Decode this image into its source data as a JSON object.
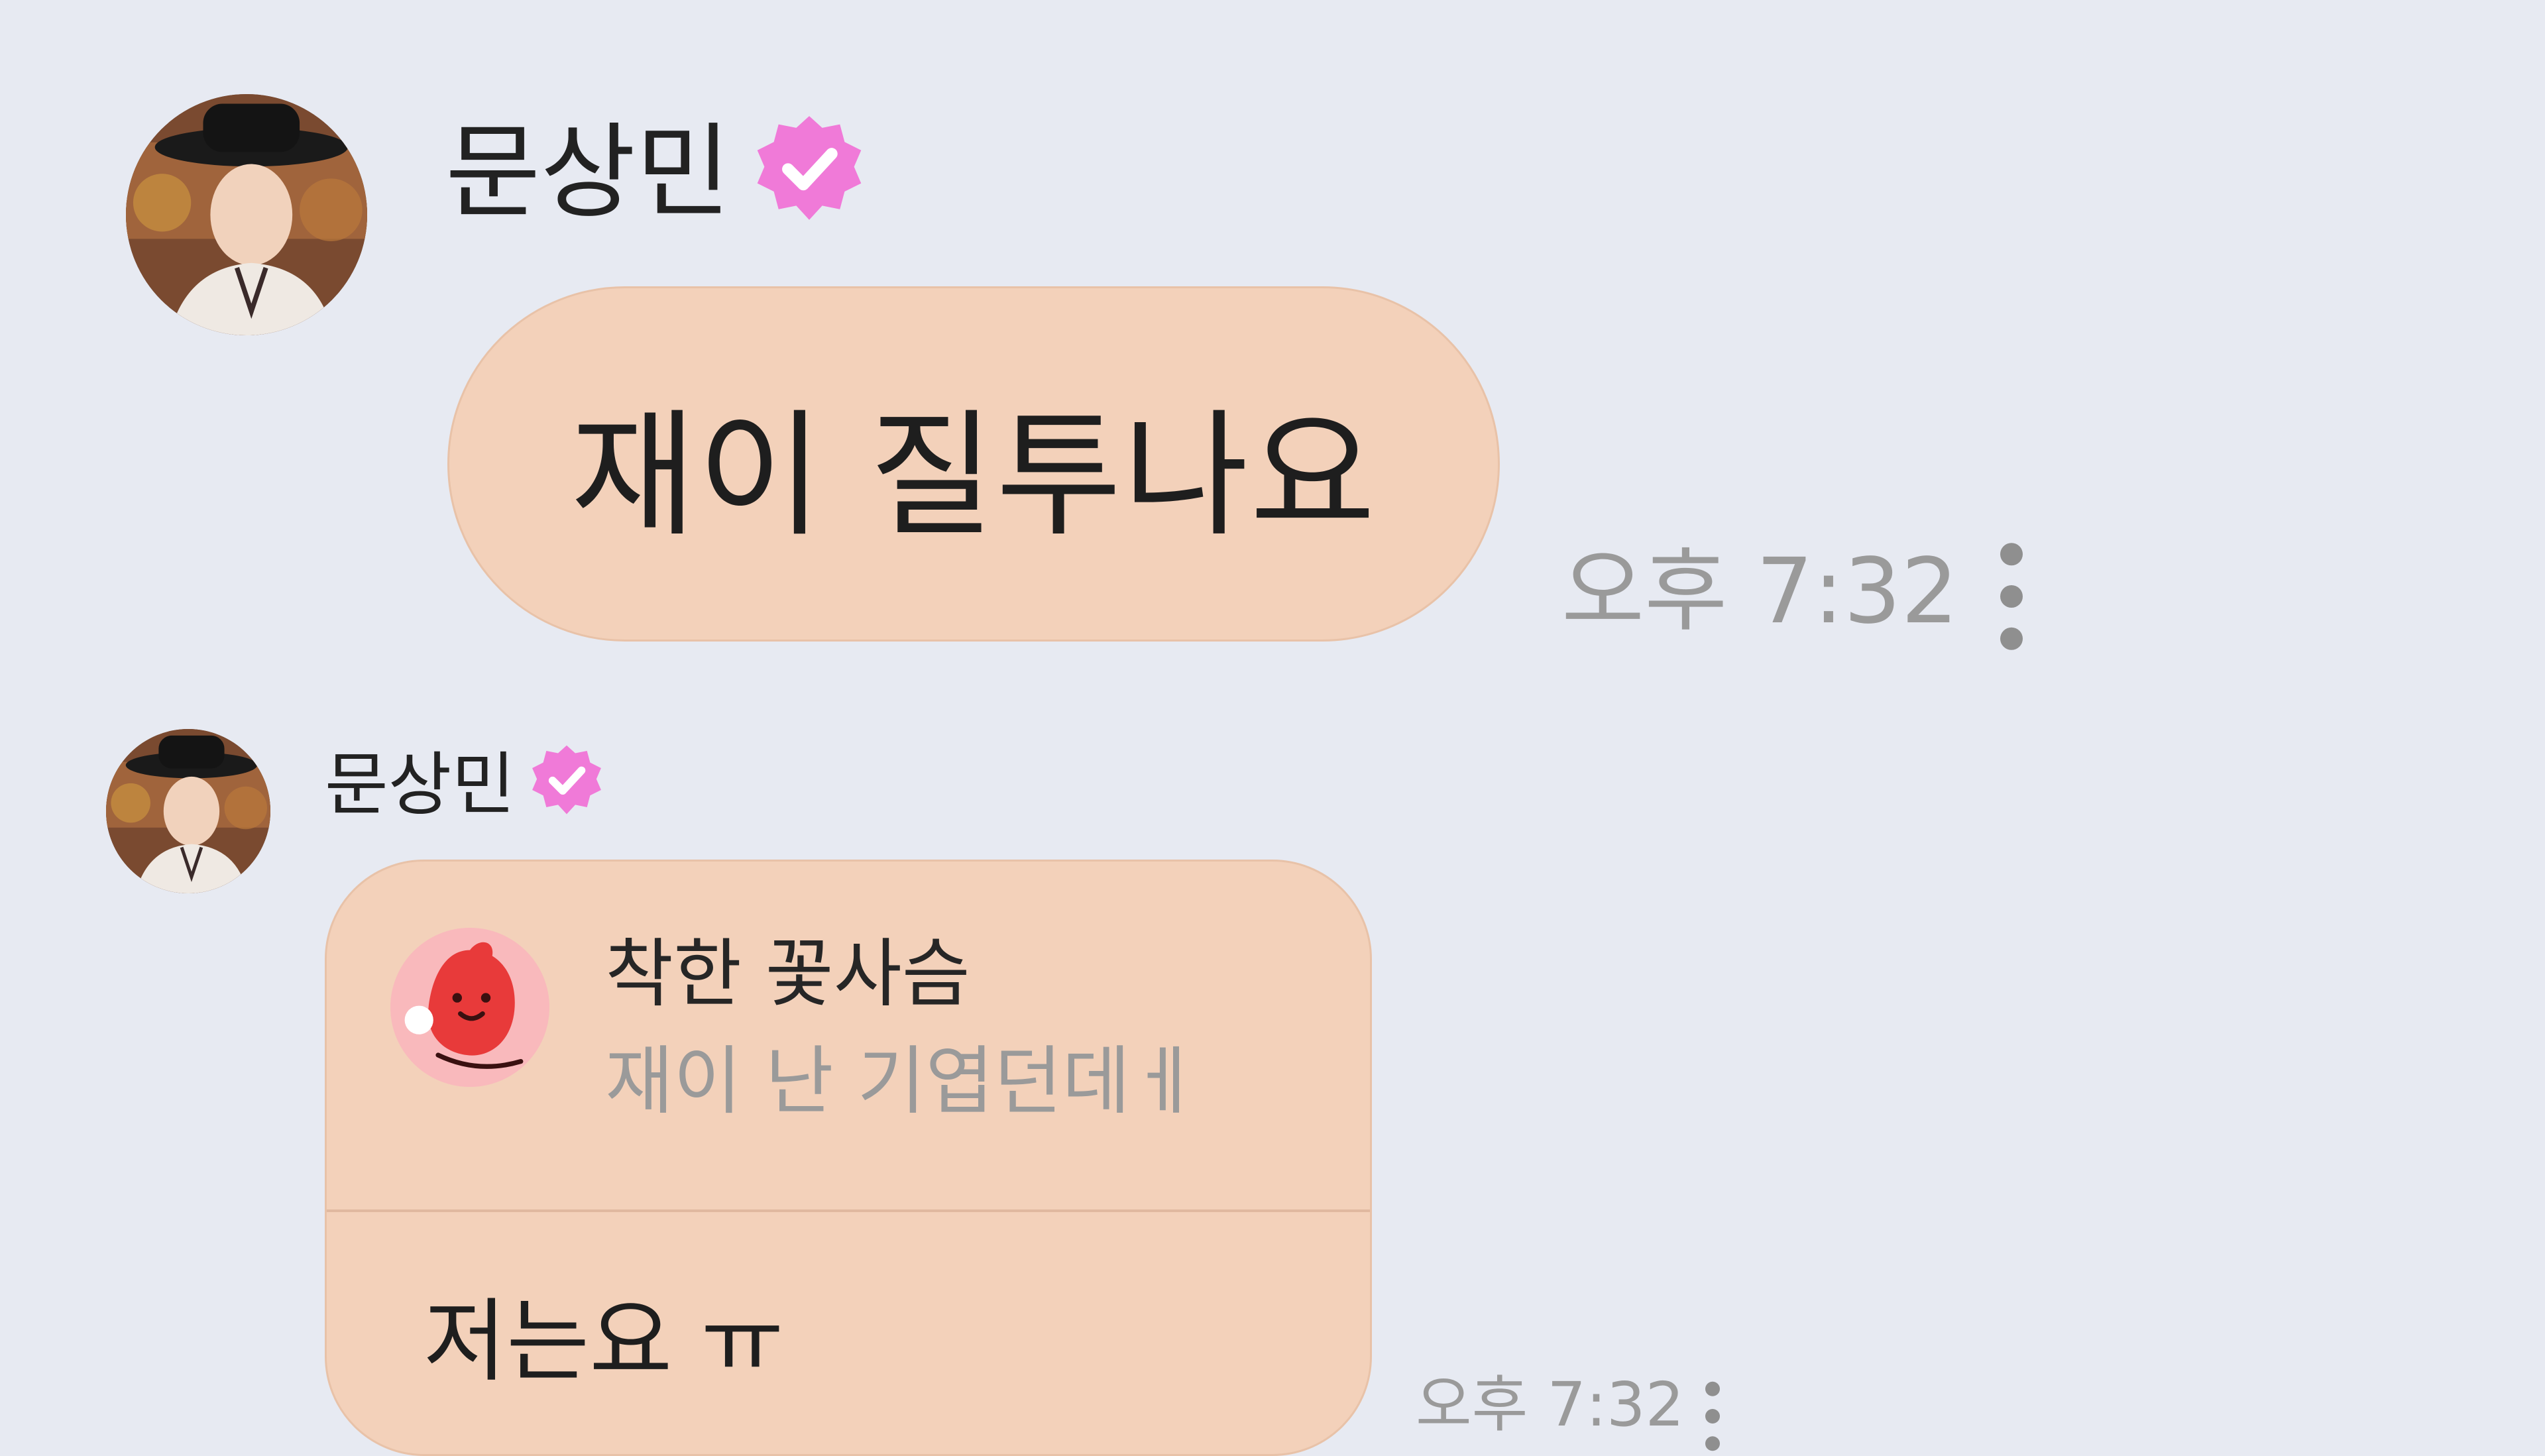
{
  "messages": [
    {
      "sender": "문상민",
      "text": "재이 질투나요",
      "time": "오후 7:32",
      "avatar_icon": "profile-avatar",
      "badge_icon": "verified-badge-icon",
      "more_icon": "more-vertical-icon"
    },
    {
      "sender": "문상민",
      "reply_to": {
        "name": "착한 꽃사슴",
        "text": "재이 난 기엽던데ㅔ",
        "icon": "fan-avatar-icon"
      },
      "text": "저는요 ㅠ",
      "time": "오후 7:32",
      "avatar_icon": "profile-avatar",
      "badge_icon": "verified-badge-icon",
      "more_icon": "more-vertical-icon"
    }
  ],
  "colors": {
    "background": "#e7eaf2",
    "bubble": "#f3d1ba",
    "badge": "#f07ad8",
    "timestamp": "#9a9a9a"
  }
}
